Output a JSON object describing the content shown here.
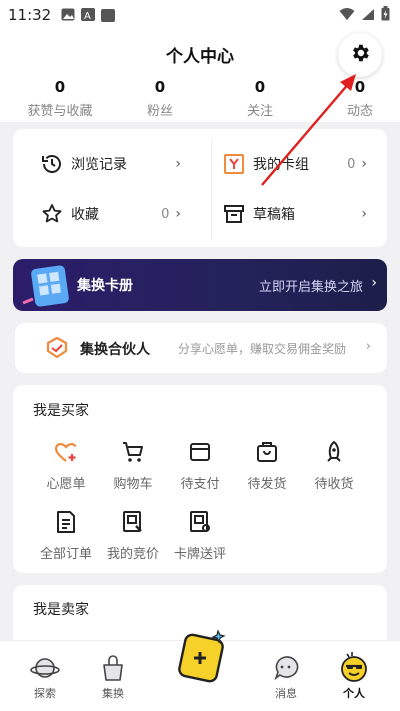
{
  "status_bar": {
    "time": "11:32"
  },
  "header": {
    "title": "个人中心"
  },
  "stats": [
    {
      "value": "0",
      "label": "获赞与收藏"
    },
    {
      "value": "0",
      "label": "粉丝"
    },
    {
      "value": "0",
      "label": "关注"
    },
    {
      "value": "0",
      "label": "动态"
    }
  ],
  "menu": {
    "history": {
      "label": "浏览记录"
    },
    "my_groups": {
      "label": "我的卡组",
      "count": "0"
    },
    "favorites": {
      "label": "收藏",
      "count": "0"
    },
    "drafts": {
      "label": "草稿箱"
    }
  },
  "banner": {
    "title": "集换卡册",
    "link": "立即开启集换之旅"
  },
  "partner": {
    "title": "集换合伙人",
    "subtitle": "分享心愿单，赚取交易佣金奖励"
  },
  "buyer": {
    "title": "我是买家",
    "items": [
      {
        "label": "心愿单",
        "icon": "heart-plus-icon"
      },
      {
        "label": "购物车",
        "icon": "cart-icon"
      },
      {
        "label": "待支付",
        "icon": "wallet-icon"
      },
      {
        "label": "待发货",
        "icon": "bag-icon"
      },
      {
        "label": "待收货",
        "icon": "rocket-icon"
      },
      {
        "label": "全部订单",
        "icon": "order-list-icon"
      },
      {
        "label": "我的竞价",
        "icon": "bid-icon"
      },
      {
        "label": "卡牌送评",
        "icon": "card-grade-icon"
      }
    ]
  },
  "seller": {
    "title": "我是卖家"
  },
  "tabs": [
    {
      "label": "探索"
    },
    {
      "label": "集换"
    },
    {
      "label": "消息"
    },
    {
      "label": "个人"
    }
  ],
  "colors": {
    "accent_orange": "#f08a3c",
    "accent_yellow": "#f5d12a",
    "annotation_red": "#e02020",
    "banner_bg": "#2b1d6b"
  }
}
